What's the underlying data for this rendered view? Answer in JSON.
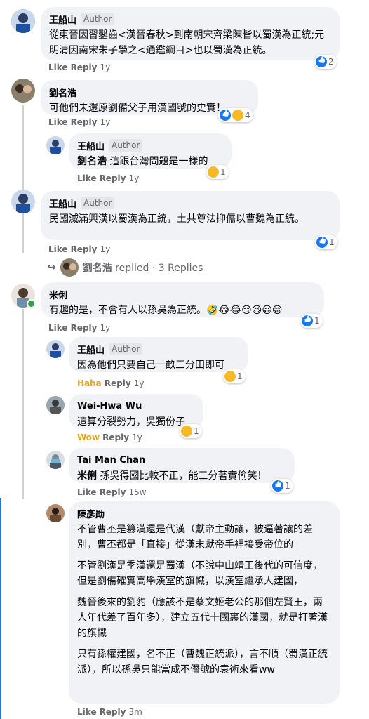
{
  "actions": {
    "like": "Like",
    "reply": "Reply",
    "haha": "Haha",
    "wow": "Wow"
  },
  "author_badge": "Author",
  "comments": [
    {
      "name": "王船山",
      "text": "從東晉因習鑿齒<漢晉春秋>到南朝宋齊梁陳皆以蜀漢為正統;元明清因南宋朱子學之<通鑑綱目>也以蜀漢為正統。",
      "time": "1y",
      "reactions": "2"
    },
    {
      "name": "劉名浩",
      "text": "可他們未還原劉備父子用漢國號的史實！",
      "time": "1y",
      "reactions": "4"
    },
    {
      "name": "王船山",
      "tag": "劉名浩",
      "text": "這跟台灣問題是一樣的",
      "time": "1y",
      "reactions": "1"
    },
    {
      "name": "王船山",
      "text": "民國滅滿興漢以蜀漢為正統，土共尊法抑儒以曹魏為正統。",
      "time": "1y",
      "reactions": "1"
    },
    {
      "name": "米俐",
      "text": "有趣的是，不會有人以孫吳為正統。🤣😂😂😏😆😀😁",
      "time": "1y",
      "reactions": "1"
    },
    {
      "name": "王船山",
      "text": "因為他們只要自己一畝三分田即可",
      "time": "1y",
      "reactions": "1"
    },
    {
      "name": "Wei-Hwa Wu",
      "text": "這算分裂勢力，吳獨份子",
      "time": "1y",
      "reactions": "1"
    },
    {
      "name": "Tai Man Chan",
      "tag": "米俐",
      "text": "孫吳得國比較不正，能三分著實偷笑！",
      "time": "15w",
      "reactions": "1"
    },
    {
      "name": "陳彥勛",
      "paragraphs": [
        "不管曹丕是篡漢還是代漢（獻帝主動讓，被逼著讓的差別，曹丕都是「直接」從漢末獻帝手裡接受帝位的",
        "不管劉漢是季漢還是蜀漢（不說中山靖王後代的可信度，但是劉備確實高舉漢室的旗幟，以漢室繼承人建國，",
        "魏晉後來的劉豹（應該不是蔡文姬老公的那個左賢王，兩人年代差了百年多），建立五代十國裏的漢國，就是打著漢的旗幟",
        "只有孫權建國，名不正（曹魏正統派），言不順（蜀漢正統派），所以孫吳只能當成不僭號的袁術來看ww"
      ],
      "time": "3m"
    }
  ],
  "replied": {
    "name": "劉名浩",
    "text": " replied · 3 Replies"
  }
}
